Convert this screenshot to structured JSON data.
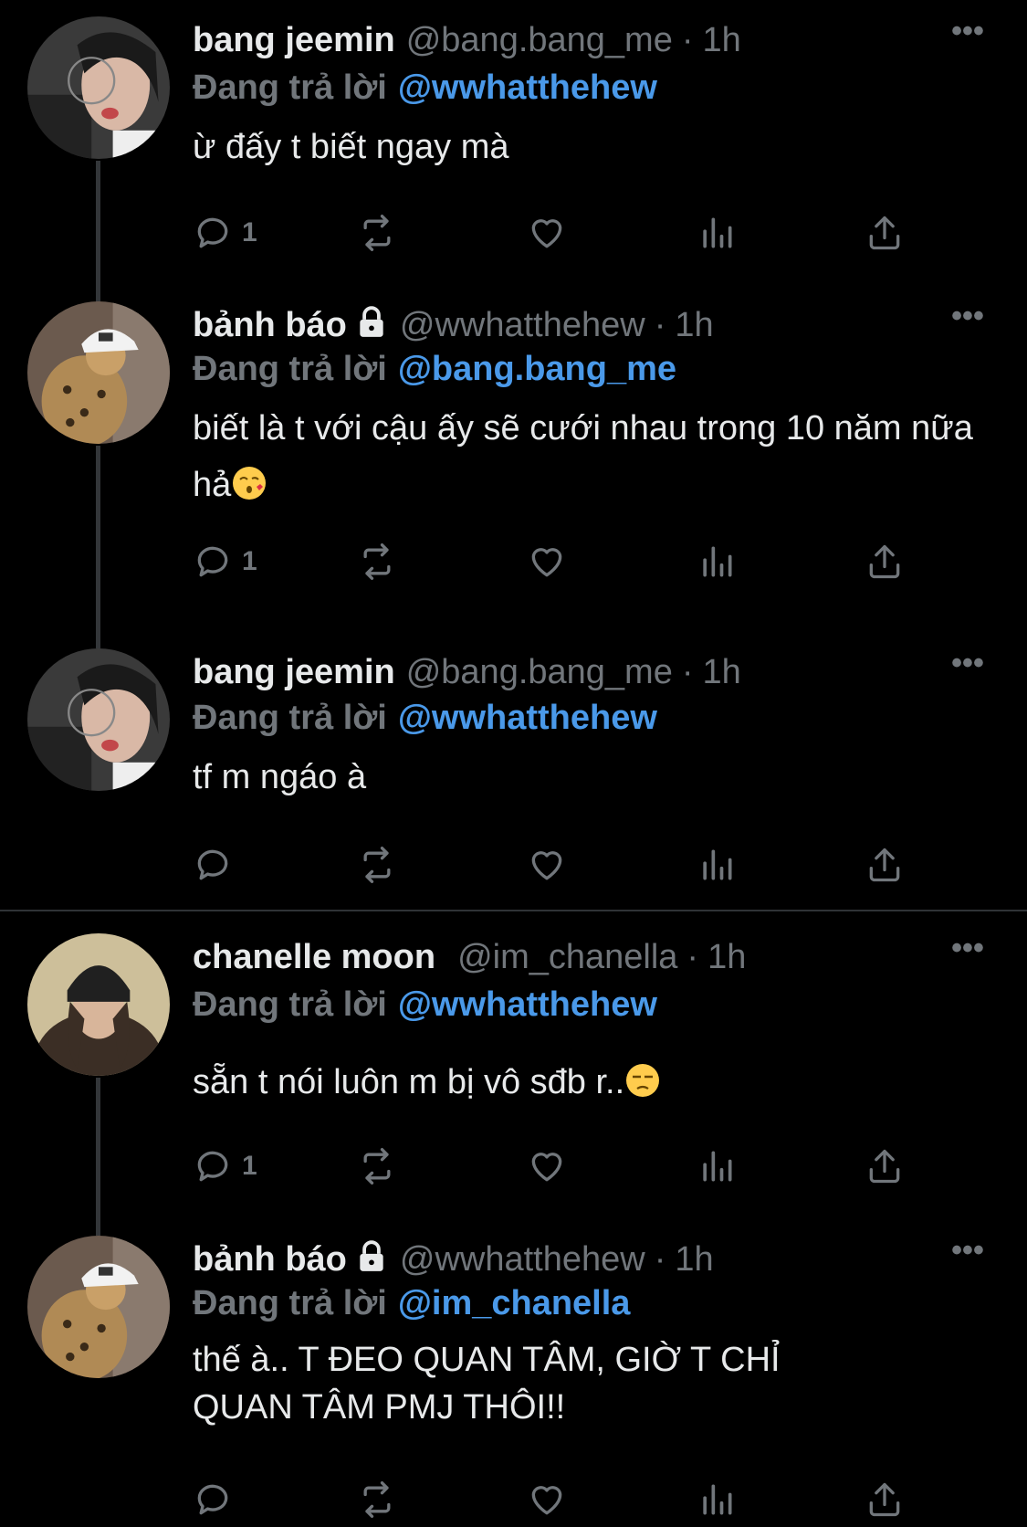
{
  "tweets": [
    {
      "name": "bang jeemin",
      "locked": false,
      "handle": "@bang.bang_me",
      "time": "1h",
      "reply_label": "Đang trả lời",
      "reply_to": "@wwhatthehew",
      "text": "ừ đấy t biết ngay mà",
      "reply_count": "1",
      "avatar_icon": "girl-glasses-avatar"
    },
    {
      "name": "bảnh báo",
      "locked": true,
      "handle": "@wwhatthehew",
      "time": "1h",
      "reply_label": "Đang trả lời",
      "reply_to": "@bang.bang_me",
      "text": "biết là t với cậu ấy sẽ cưới nhau trong 10 năm nữa hả",
      "text_emoji": "kissing-face-emoji",
      "reply_count": "1",
      "avatar_icon": "leopard-cap-avatar"
    },
    {
      "name": "bang jeemin",
      "locked": false,
      "handle": "@bang.bang_me",
      "time": "1h",
      "reply_label": "Đang trả lời",
      "reply_to": "@wwhatthehew",
      "text": "tf m ngáo à",
      "reply_count": "",
      "avatar_icon": "girl-glasses-avatar"
    },
    {
      "name": "chanelle moon",
      "locked": false,
      "handle": "@im_chanella",
      "time": "1h",
      "reply_label": "Đang trả lời",
      "reply_to": "@wwhatthehew",
      "text": "sẵn t nói luôn m bị vô sđb r..",
      "text_emoji": "unamused-face-emoji",
      "reply_count": "1",
      "avatar_icon": "girl-beanie-avatar"
    },
    {
      "name": "bảnh báo",
      "locked": true,
      "handle": "@wwhatthehew",
      "time": "1h",
      "reply_label": "Đang trả lời",
      "reply_to": "@im_chanella",
      "text": "thế à.. T ĐEO QUAN TÂM, GIỜ T CHỈ QUAN TÂM PMJ THÔI!!",
      "reply_count": "",
      "avatar_icon": "leopard-cap-avatar"
    }
  ],
  "icons": {
    "more": "more-dots-icon",
    "reply": "reply-bubble-icon",
    "retweet": "retweet-icon",
    "like": "heart-icon",
    "views": "views-bars-icon",
    "share": "share-upload-icon",
    "lock": "lock-icon"
  },
  "colors": {
    "background": "#000000",
    "text": "#e7e9ea",
    "muted": "#71767b",
    "link": "#4a99e9",
    "thread_line": "#333639"
  },
  "more_glyph": "•••",
  "dot_separator": "·"
}
